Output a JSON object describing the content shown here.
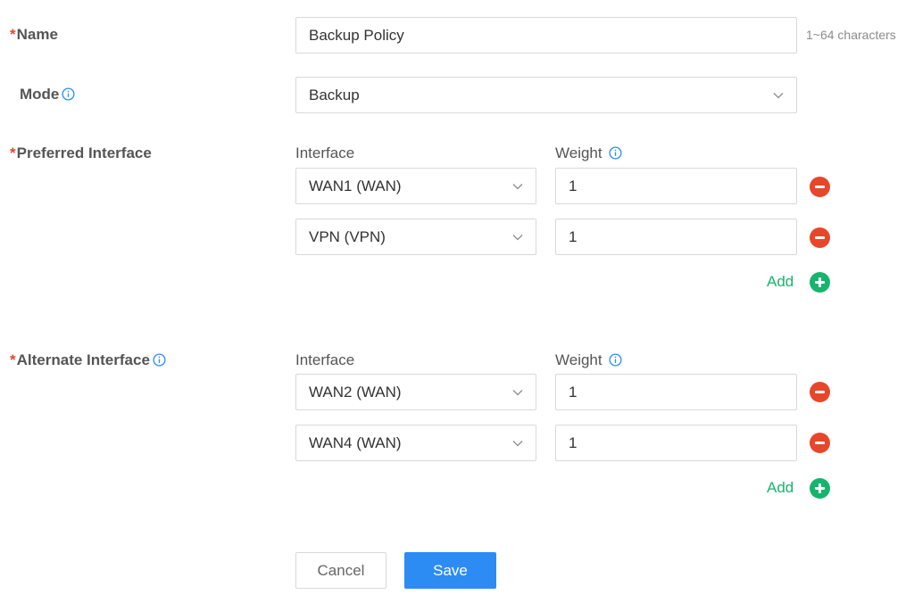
{
  "name_row": {
    "required_mark": "*",
    "label": "Name",
    "value": "Backup Policy",
    "hint": "1~64 characters"
  },
  "mode_row": {
    "label": "Mode",
    "value": "Backup"
  },
  "preferred": {
    "required_mark": "*",
    "label": "Preferred Interface",
    "interface_header": "Interface",
    "weight_header": "Weight",
    "rows": [
      {
        "interface": "WAN1 (WAN)",
        "weight": "1"
      },
      {
        "interface": "VPN (VPN)",
        "weight": "1"
      }
    ],
    "add_label": "Add"
  },
  "alternate": {
    "required_mark": "*",
    "label": "Alternate Interface",
    "interface_header": "Interface",
    "weight_header": "Weight",
    "rows": [
      {
        "interface": "WAN2 (WAN)",
        "weight": "1"
      },
      {
        "interface": "WAN4 (WAN)",
        "weight": "1"
      }
    ],
    "add_label": "Add"
  },
  "actions": {
    "cancel_label": "Cancel",
    "save_label": "Save"
  },
  "colors": {
    "required": "#e8462a",
    "add": "#16b46c",
    "remove": "#e8462a",
    "primary": "#2c8cf4",
    "info": "#2c8cf4"
  },
  "icons": [
    "info-icon",
    "chevron-down-icon",
    "minus-circle-icon",
    "plus-circle-icon"
  ]
}
